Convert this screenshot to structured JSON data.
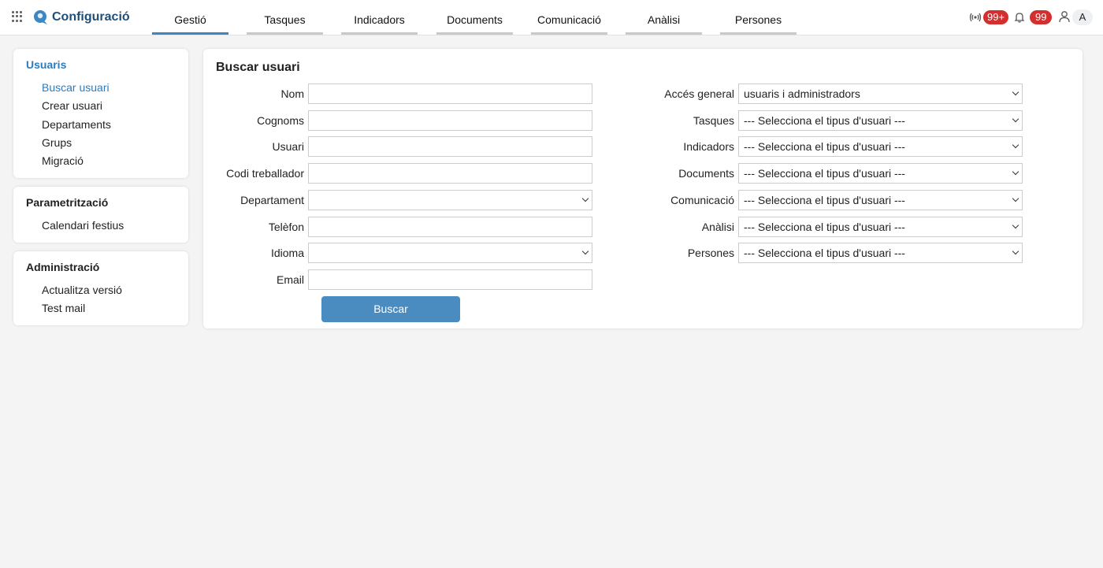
{
  "app": {
    "title": "Configuració",
    "brand_color": "#1f4e79",
    "accent_color": "#2b7bbf"
  },
  "nav": {
    "tabs": [
      {
        "label": "Gestió",
        "active": true
      },
      {
        "label": "Tasques"
      },
      {
        "label": "Indicadors"
      },
      {
        "label": "Documents"
      },
      {
        "label": "Comunicació"
      },
      {
        "label": "Anàlisi"
      },
      {
        "label": "Persones"
      }
    ]
  },
  "header": {
    "broadcast_count": "99+",
    "notifications_count": "99",
    "avatar_initial": "A",
    "icons": [
      "apps-icon",
      "logo-icon",
      "broadcast-icon",
      "bell-icon",
      "user-icon"
    ]
  },
  "sidebar": {
    "sections": [
      {
        "title": "Usuaris",
        "items": [
          "Buscar usuari",
          "Crear usuari",
          "Departaments",
          "Grups",
          "Migració"
        ]
      },
      {
        "title": "Parametrització",
        "items": [
          "Calendari festius"
        ]
      },
      {
        "title": "Administració",
        "items": [
          "Actualitza versió",
          "Test mail"
        ]
      }
    ]
  },
  "main": {
    "title": "Buscar usuari",
    "left_fields": [
      {
        "label": "Nom",
        "value": ""
      },
      {
        "label": "Cognoms",
        "value": ""
      },
      {
        "label": "Usuari",
        "value": ""
      },
      {
        "label": "Codi treballador",
        "value": ""
      },
      {
        "label": "Departament",
        "value": ""
      },
      {
        "label": "Telèfon",
        "value": ""
      },
      {
        "label": "Idioma",
        "value": ""
      },
      {
        "label": "Email",
        "value": ""
      }
    ],
    "right_fields": [
      {
        "label": "Accés general",
        "value": "usuaris i administradors"
      },
      {
        "label": "Tasques",
        "value": "--- Selecciona el tipus d'usuari ---"
      },
      {
        "label": "Indicadors",
        "value": "--- Selecciona el tipus d'usuari ---"
      },
      {
        "label": "Documents",
        "value": "--- Selecciona el tipus d'usuari ---"
      },
      {
        "label": "Comunicació",
        "value": "--- Selecciona el tipus d'usuari ---"
      },
      {
        "label": "Anàlisi",
        "value": "--- Selecciona el tipus d'usuari ---"
      },
      {
        "label": "Persones",
        "value": "--- Selecciona el tipus d'usuari ---"
      }
    ],
    "search_button": "Buscar"
  }
}
